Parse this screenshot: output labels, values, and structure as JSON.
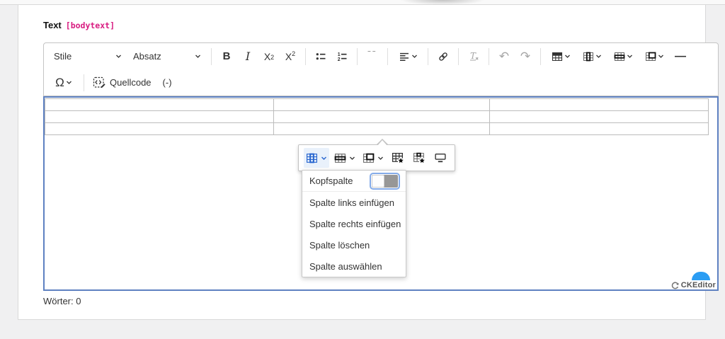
{
  "field_label": {
    "name": "Text",
    "key": "[bodytext]"
  },
  "toolbar": {
    "style_dropdown": "Stile",
    "paragraph_dropdown": "Absatz",
    "bold": "B",
    "italic": "I",
    "sub_base": "X",
    "sub_digit": "2",
    "sup_base": "X",
    "sup_digit": "2",
    "blockquote_glyph": "“",
    "undo_glyph": "↶",
    "redo_glyph": "↷",
    "hline_glyph": "—",
    "omega": "Ω",
    "source_label": "Quellcode",
    "minus_label": "(-)",
    "icon_names_row1": [
      "style-dropdown",
      "paragraph-dropdown",
      "bold",
      "italic",
      "subscript",
      "superscript",
      "bulleted-list",
      "numbered-list",
      "blockquote",
      "text-alignment",
      "link",
      "remove-format",
      "undo",
      "redo",
      "insert-table",
      "table-column",
      "table-row",
      "merge-cells",
      "horizontal-line"
    ],
    "icon_names_row2": [
      "special-characters",
      "source-editing",
      "minus"
    ]
  },
  "balloon_toolbar": {
    "icon_names": [
      "table-column",
      "table-row",
      "merge-cells",
      "table-properties",
      "cell-properties",
      "toggle-caption"
    ],
    "active_item": "table-column"
  },
  "column_menu": {
    "header_toggle_label": "Kopfspalte",
    "toggle_state": "off",
    "items": [
      "Spalte links einfügen",
      "Spalte rechts einfügen",
      "Spalte löschen",
      "Spalte auswählen"
    ]
  },
  "editor": {
    "table_rows": 3,
    "table_cols": 3,
    "content": ""
  },
  "word_count": "Wörter: 0",
  "badge_label": "CKEditor",
  "colors": {
    "accent_blue": "#2765cf",
    "focus_border": "#5e81c1",
    "field_key_pink": "#d81b80",
    "badge_blue": "#2b9df3",
    "disabled_gray": "#a6a6a6"
  }
}
